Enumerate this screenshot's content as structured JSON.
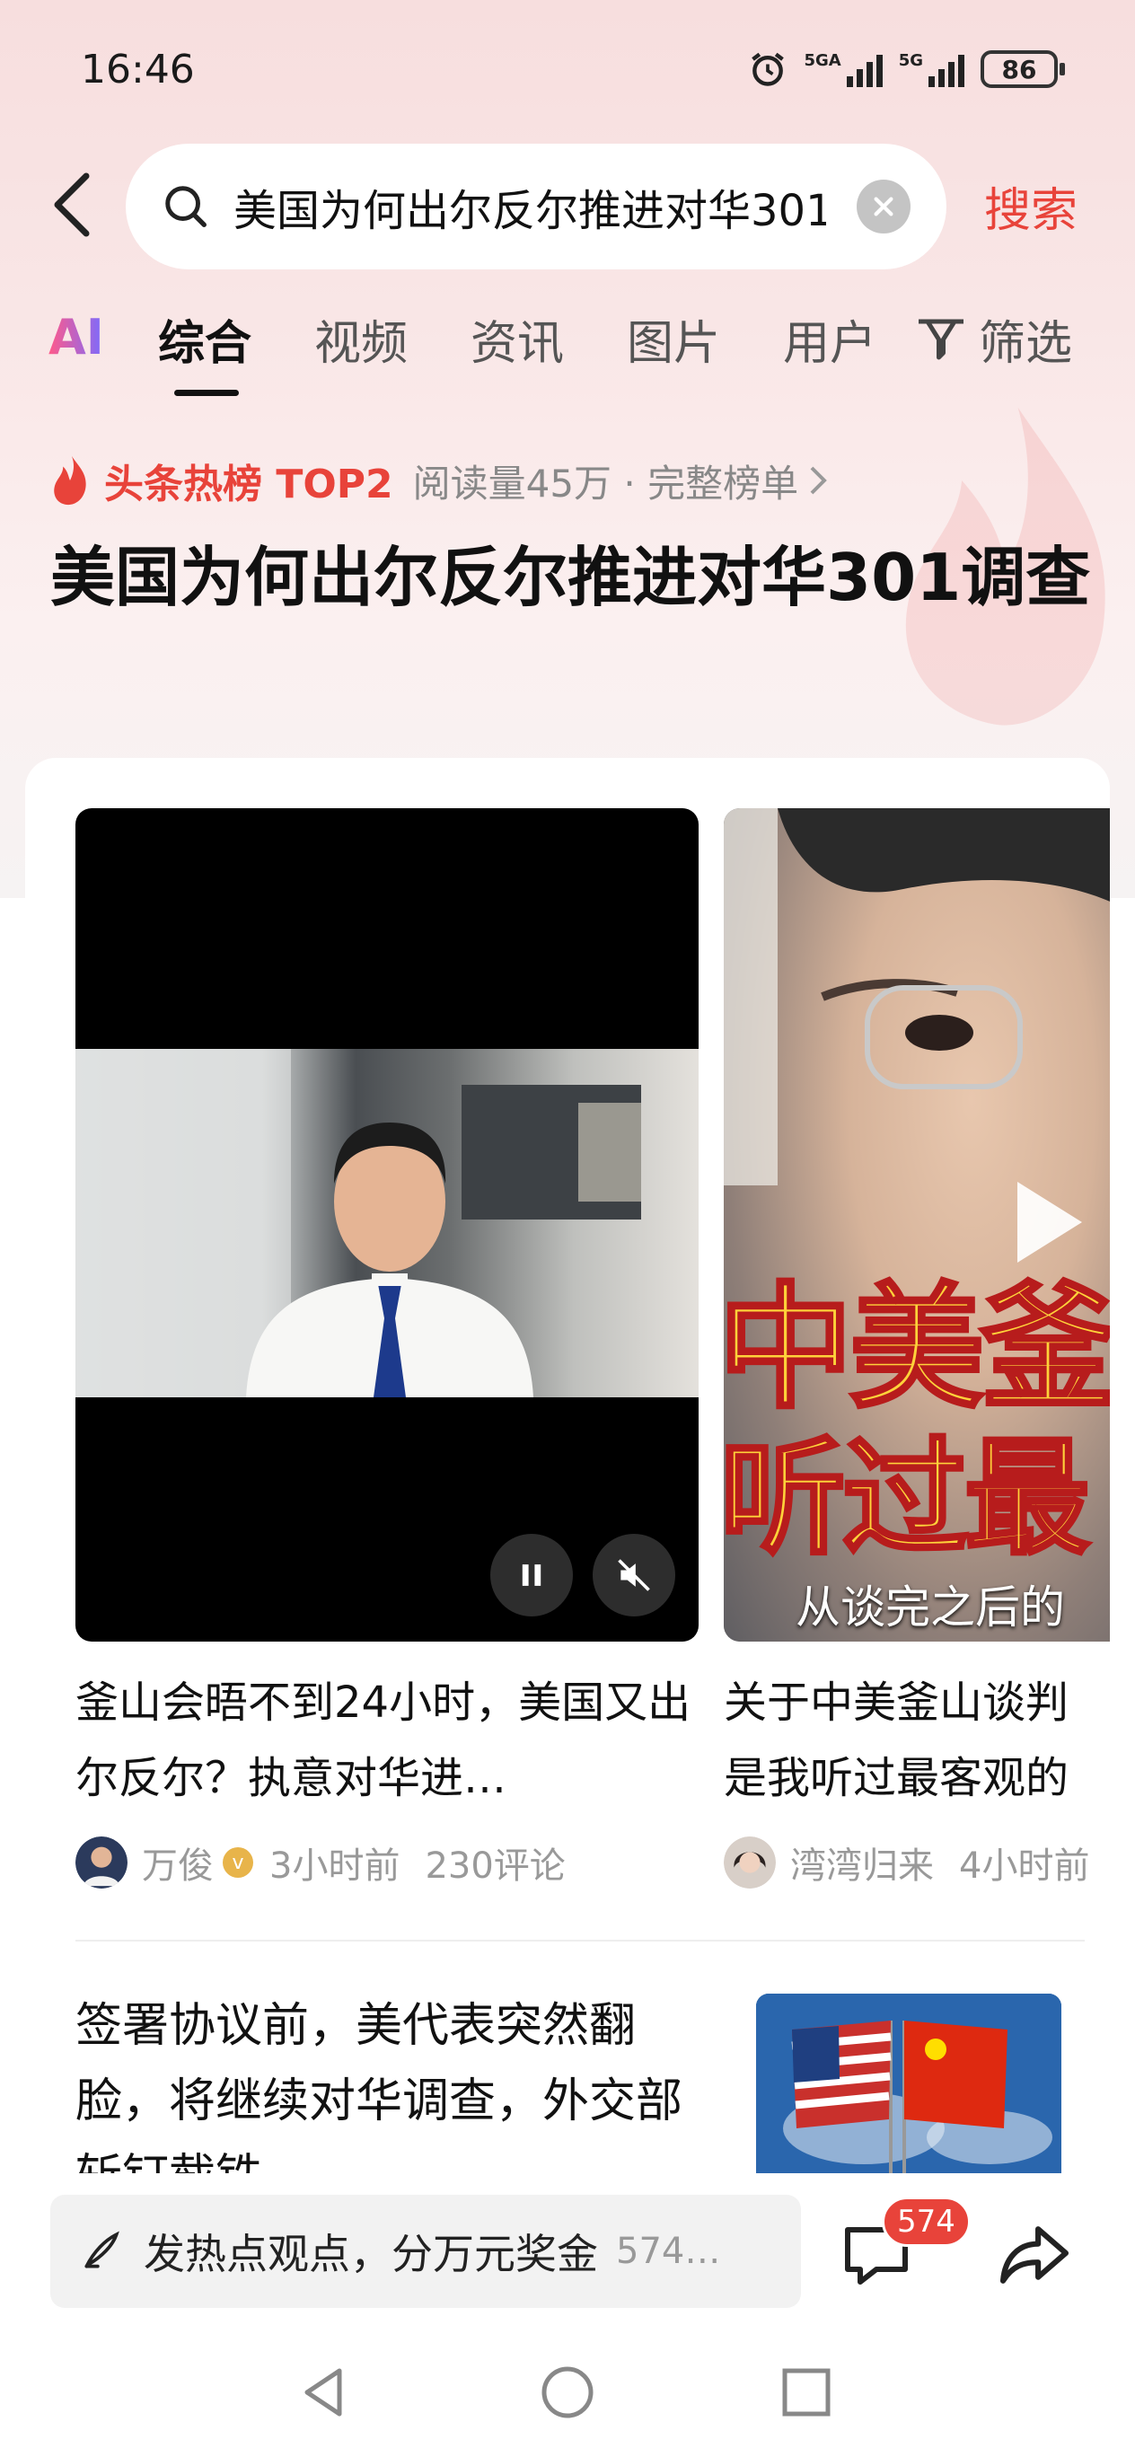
{
  "status_bar": {
    "time": "16:46",
    "signal1_label": "5GA",
    "signal2_label": "5G",
    "battery": "86"
  },
  "search": {
    "query": "美国为何出尔反尔推进对华301调查",
    "button_label": "搜索"
  },
  "tabs": {
    "ai": "AI",
    "items": [
      "综合",
      "视频",
      "资讯",
      "图片",
      "用户"
    ],
    "active_index": 0,
    "filter_label": "筛选"
  },
  "hot_rank": {
    "label": "头条热榜 TOP2",
    "meta": "阅读量45万 · 完整榜单"
  },
  "topic_title": "美国为何出尔反尔推进对华301调查",
  "results": {
    "video1": {
      "title": "釜山会晤不到24小时，美国又出尔反尔？执意对华进…",
      "author": "万俊",
      "verified_mark": "v",
      "time": "3小时前",
      "comments": "230评论"
    },
    "video2": {
      "overlay_line1": "中美釜山",
      "overlay_line2": "听过最",
      "overlay_sub": "从谈完之后的",
      "title_line1": "关于中美釜山谈判",
      "title_line2": "是我听过最客观的",
      "author": "湾湾归来",
      "time": "4小时前"
    },
    "article1": {
      "title": "签署协议前，美代表突然翻脸，将继续对华调查，外交部斩钉截铁"
    }
  },
  "bottom_bar": {
    "comment_prompt": "发热点观点，分万元奖金",
    "comment_count_preview": "574…",
    "comment_badge": "574"
  },
  "colors": {
    "accent": "#e8433a",
    "text": "#111111",
    "muted": "#999999"
  }
}
